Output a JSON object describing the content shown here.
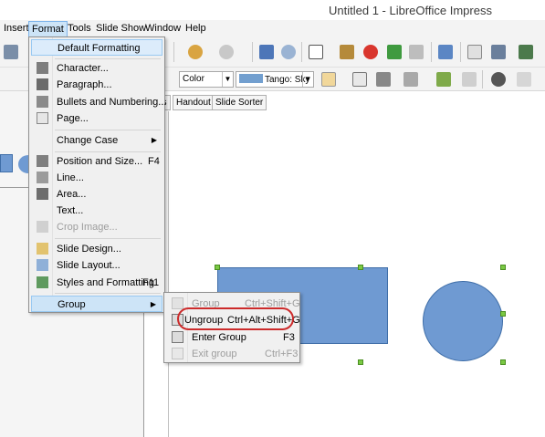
{
  "window": {
    "title": "Untitled 1 - LibreOffice Impress"
  },
  "menubar": [
    "Insert",
    "Format",
    "Tools",
    "Slide Show",
    "Window",
    "Help"
  ],
  "toolbar": {
    "fill_combo": "Color",
    "color_combo": "Tango: Sky"
  },
  "view_tabs": [
    "es",
    "Handout",
    "Slide Sorter"
  ],
  "format_menu": {
    "items": [
      {
        "label": "Default Formatting",
        "shortcut": ""
      },
      {
        "label": "Character...",
        "shortcut": ""
      },
      {
        "label": "Paragraph...",
        "shortcut": ""
      },
      {
        "label": "Bullets and Numbering...",
        "shortcut": ""
      },
      {
        "label": "Page...",
        "shortcut": ""
      },
      {
        "label": "Change Case",
        "shortcut": ""
      },
      {
        "label": "Position and Size...",
        "shortcut": "F4"
      },
      {
        "label": "Line...",
        "shortcut": ""
      },
      {
        "label": "Area...",
        "shortcut": ""
      },
      {
        "label": "Text...",
        "shortcut": ""
      },
      {
        "label": "Crop Image...",
        "shortcut": ""
      },
      {
        "label": "Slide Design...",
        "shortcut": ""
      },
      {
        "label": "Slide Layout...",
        "shortcut": ""
      },
      {
        "label": "Styles and Formatting",
        "shortcut": "F11"
      },
      {
        "label": "Group",
        "shortcut": ""
      }
    ]
  },
  "group_submenu": {
    "items": [
      {
        "label": "Group",
        "shortcut": "Ctrl+Shift+G"
      },
      {
        "label": "Ungroup",
        "shortcut": "Ctrl+Alt+Shift+G"
      },
      {
        "label": "Enter Group",
        "shortcut": "F3"
      },
      {
        "label": "Exit group",
        "shortcut": "Ctrl+F3"
      }
    ]
  },
  "colors": {
    "shape_fill": "#6f9ad2",
    "highlight_oval": "#cc2b2b",
    "handle": "#7ac943",
    "menu_highlight": "#cde4f7"
  },
  "icons": [
    "save-icon",
    "spellcheck-icon",
    "zoom-icon",
    "table-icon",
    "chart-icon",
    "undo-icon",
    "redo-icon"
  ]
}
